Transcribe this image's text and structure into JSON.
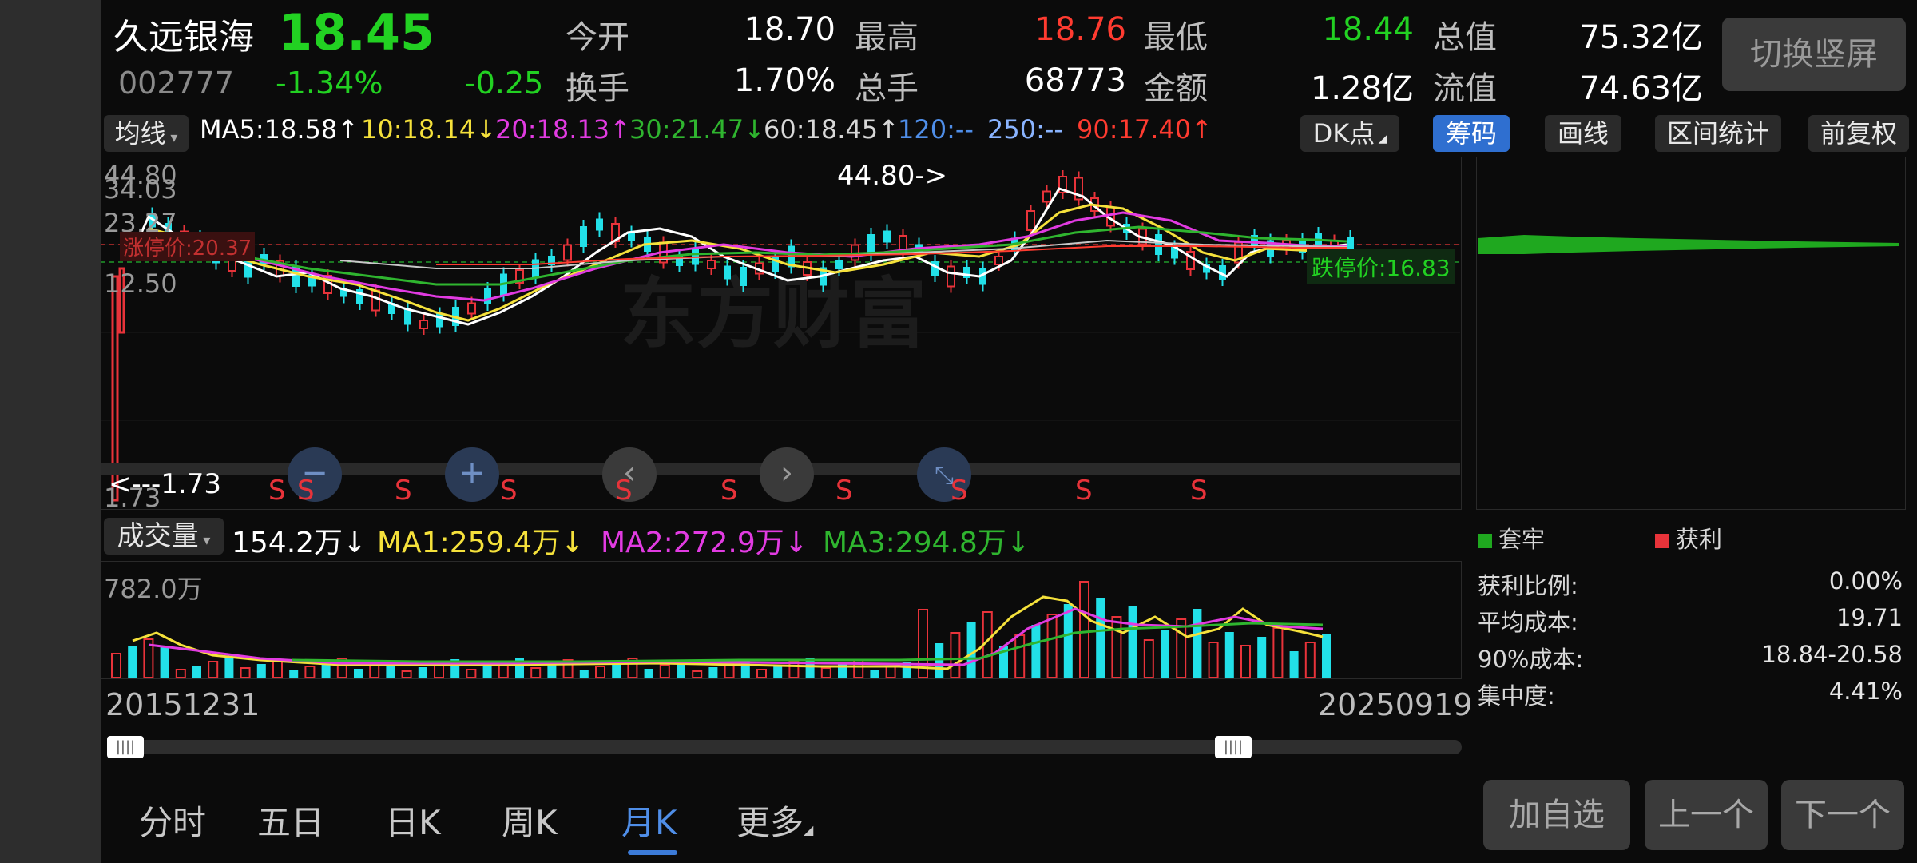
{
  "header": {
    "stock_name": "久远银海",
    "price": "18.45",
    "code": "002777",
    "change_pct": "-1.34%",
    "change_abs": "-0.25",
    "stats": [
      {
        "label": "今开",
        "value": "18.70",
        "color": "#ffffff"
      },
      {
        "label": "最高",
        "value": "18.76",
        "color": "#ff3b30"
      },
      {
        "label": "最低",
        "value": "18.44",
        "color": "#22d122"
      },
      {
        "label": "总值",
        "value": "75.32亿",
        "color": "#ffffff"
      },
      {
        "label": "换手",
        "value": "1.70%",
        "color": "#ffffff"
      },
      {
        "label": "总手",
        "value": "68773",
        "color": "#ffffff"
      },
      {
        "label": "金额",
        "value": "1.28亿",
        "color": "#ffffff"
      },
      {
        "label": "流值",
        "value": "74.63亿",
        "color": "#ffffff"
      }
    ],
    "switch_label": "切换竖屏"
  },
  "ma_row": {
    "selector": "均线",
    "items": [
      {
        "text": "MA5:18.58↑",
        "color": "#ffffff"
      },
      {
        "text": "10:18.14↓",
        "color": "#f5e13b"
      },
      {
        "text": "20:18.13↑",
        "color": "#e23be2"
      },
      {
        "text": "30:21.47↓",
        "color": "#2fb52f"
      },
      {
        "text": "60:18.45↑",
        "color": "#d8d8d8"
      },
      {
        "text": "120:--",
        "color": "#4f8ee8"
      },
      {
        "text": "250:--",
        "color": "#8ab4ff"
      },
      {
        "text": "90:17.40↑",
        "color": "#ff3b30"
      }
    ],
    "tools": {
      "dk": "DK点",
      "chip": "筹码",
      "draw": "画线",
      "range": "区间统计",
      "adjust": "前复权"
    }
  },
  "kline": {
    "y_labels": [
      "44.80",
      "34.03",
      "23.27",
      "12.50",
      "1.73"
    ],
    "max_marker": "44.80->",
    "min_marker": "<---1.73",
    "limit_down": "跌停价:16.83",
    "limit_up_partial": "涨停价:20.37",
    "watermark": "东方财富",
    "s_label": "S"
  },
  "volume": {
    "selector": "成交量",
    "current": "154.2万↓",
    "ma1": "MA1:259.4万↓",
    "ma2": "MA2:272.9万↓",
    "ma3": "MA3:294.8万↓",
    "max_label": "782.0万"
  },
  "dates": {
    "start": "20151231",
    "end": "20250919"
  },
  "chips": {
    "legend_trapped": "套牢",
    "legend_profit": "获利",
    "rows": [
      {
        "label": "获利比例:",
        "value": "0.00%"
      },
      {
        "label": "平均成本:",
        "value": "19.71"
      },
      {
        "label": "90%成本:",
        "value": "18.84-20.58"
      },
      {
        "label": "集中度:",
        "value": "4.41%"
      }
    ]
  },
  "tabs": [
    {
      "label": "分时"
    },
    {
      "label": "五日"
    },
    {
      "label": "日K"
    },
    {
      "label": "周K"
    },
    {
      "label": "月K",
      "active": true
    },
    {
      "label": "更多"
    }
  ],
  "buttons": {
    "add_watch": "加自选",
    "prev": "上一个",
    "next": "下一个"
  },
  "colors": {
    "up": "#e8333a",
    "down": "#22e0e8",
    "green_text": "#22d122",
    "red_text": "#ff3b30",
    "accent_blue": "#3c7bd8"
  }
}
